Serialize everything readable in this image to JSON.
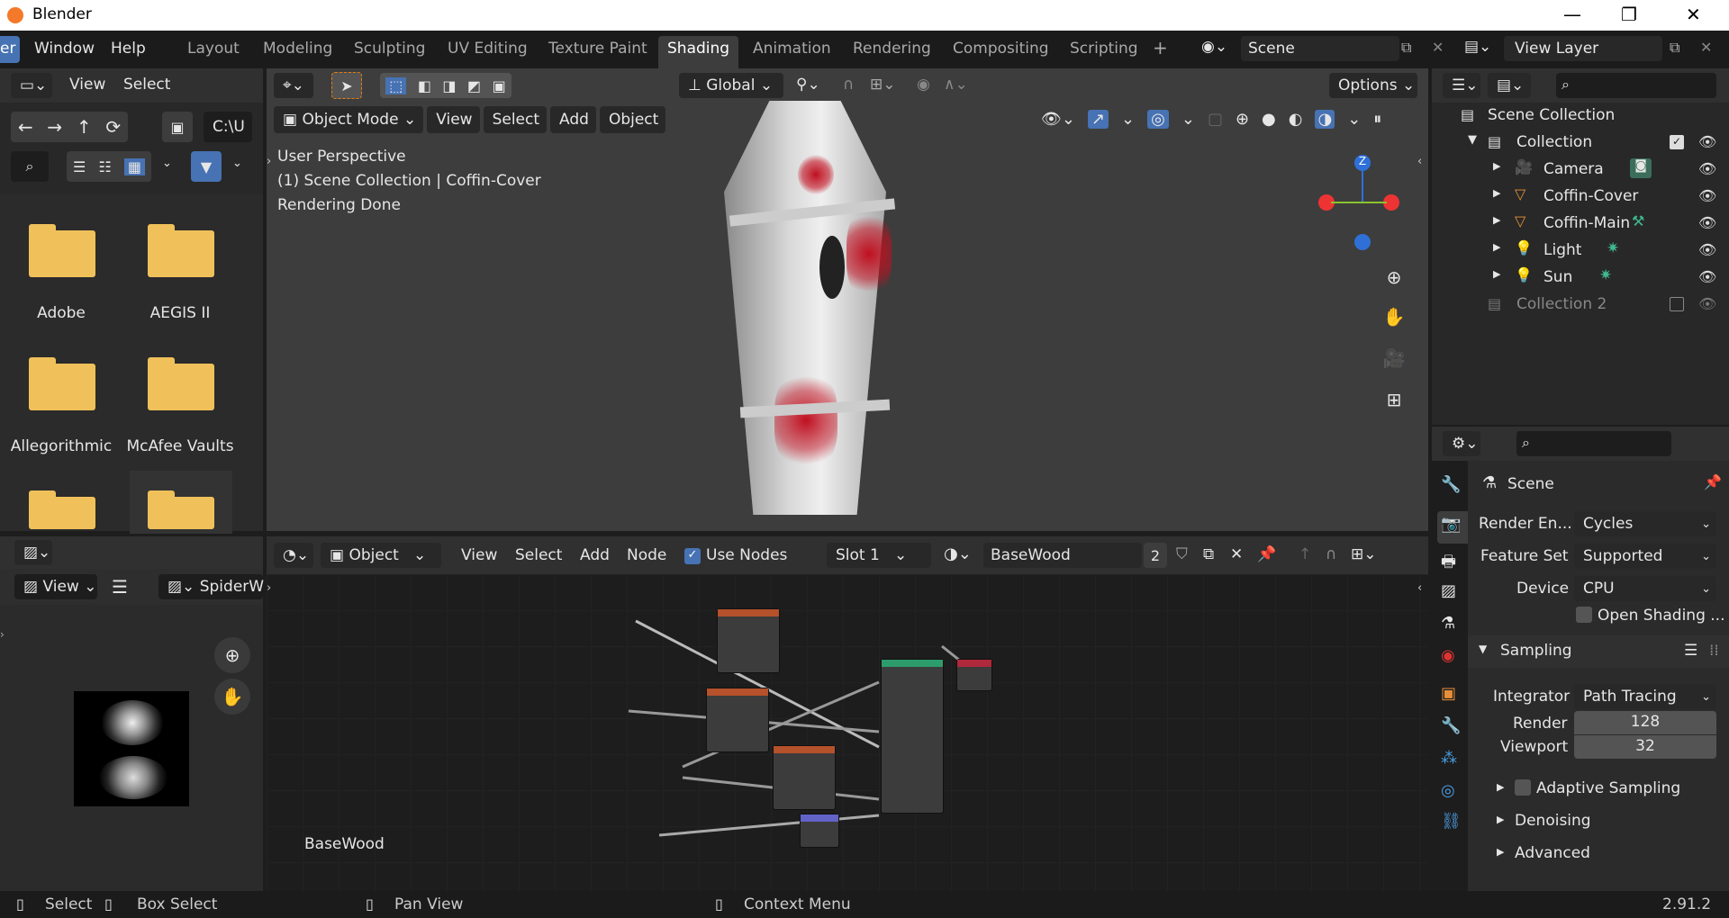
{
  "titlebar": {
    "app_title": "Blender",
    "minimize": "—",
    "maximize": "❐",
    "close": "✕"
  },
  "menu": {
    "file_partial": "er",
    "window": "Window",
    "help": "Help"
  },
  "workspaces": [
    "Layout",
    "Modeling",
    "Sculpting",
    "UV Editing",
    "Texture Paint",
    "Shading",
    "Animation",
    "Rendering",
    "Compositing",
    "Scripting"
  ],
  "workspace_add": "+",
  "scene_field": "Scene",
  "view_layer_field": "View Layer",
  "file_browser": {
    "menu_view": "View",
    "menu_select": "Select",
    "path": "C:\\U",
    "folders": [
      "Adobe",
      "AEGIS II",
      "Allegorithmic",
      "McAfee Vaults"
    ]
  },
  "image_editor": {
    "view": "View",
    "image_name": "SpiderW"
  },
  "viewport": {
    "orientation": "Global",
    "options": "Options",
    "mode": "Object Mode",
    "menu_view": "View",
    "menu_select": "Select",
    "menu_add": "Add",
    "menu_object": "Object",
    "overlay_line1": "User Perspective",
    "overlay_line2": "(1) Scene Collection | Coffin-Cover",
    "overlay_line3": "Rendering Done",
    "gizmo_z": "Z"
  },
  "node_editor": {
    "type": "Object",
    "menu_view": "View",
    "menu_select": "Select",
    "menu_add": "Add",
    "menu_node": "Node",
    "use_nodes": "Use Nodes",
    "slot": "Slot 1",
    "material": "BaseWood",
    "users": "2",
    "material_label": "BaseWood"
  },
  "outliner": {
    "scene_collection": "Scene Collection",
    "collection": "Collection",
    "items": [
      "Camera",
      "Coffin-Cover",
      "Coffin-Main",
      "Light",
      "Sun"
    ],
    "collection2": "Collection 2"
  },
  "properties": {
    "context": "Scene",
    "render_engine_label": "Render En...",
    "render_engine": "Cycles",
    "feature_set_label": "Feature Set",
    "feature_set": "Supported",
    "device_label": "Device",
    "device": "CPU",
    "open_shading": "Open Shading ...",
    "sampling": "Sampling",
    "integrator_label": "Integrator",
    "integrator": "Path Tracing",
    "render_label": "Render",
    "render_samples": "128",
    "viewport_label": "Viewport",
    "viewport_samples": "32",
    "adaptive_sampling": "Adaptive Sampling",
    "denoising": "Denoising",
    "advanced": "Advanced"
  },
  "statusbar": {
    "select": "Select",
    "box_select": "Box Select",
    "pan_view": "Pan View",
    "context_menu": "Context Menu",
    "version": "2.91.2"
  }
}
